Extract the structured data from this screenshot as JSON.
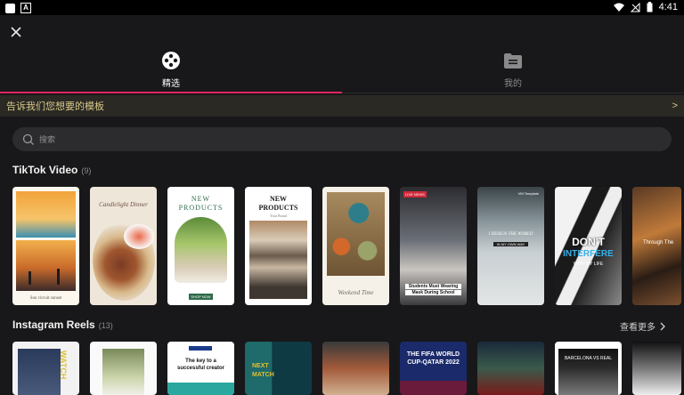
{
  "status_bar": {
    "time": "4:41",
    "badge": "A"
  },
  "tabs": [
    {
      "label": "精选",
      "active": true,
      "icon": "film-reel-icon"
    },
    {
      "label": "我的",
      "active": false,
      "icon": "folder-icon"
    }
  ],
  "banner": {
    "text": "告诉我们您想要的模板",
    "arrow": ">"
  },
  "search": {
    "placeholder": "搜索"
  },
  "sections": [
    {
      "title": "TikTok Video",
      "count": "(9)",
      "cards": [
        {
          "line1": "",
          "line2": "Sun circuit sunset"
        },
        {
          "line1": "Candlelight Dinner",
          "line2": ""
        },
        {
          "line1": "NEW",
          "line2": "PRODUCTS",
          "cta": "SHOP NOW"
        },
        {
          "line1": "NEW",
          "line2": "PRODUCTS",
          "sub": "Your Brand"
        },
        {
          "line1": "",
          "line2": "Weekend Time"
        },
        {
          "line1": "Students Must Wearing",
          "line2": "Mask During School",
          "tag": "LIVE NEWS"
        },
        {
          "line1": "I DESIGN THE WORLD",
          "line2": "IN MY OWN WAY",
          "tag": "VM Template"
        },
        {
          "line1": "DON'T",
          "line2": "INTERFERE",
          "line3": "WITH MY LIFE"
        },
        {
          "line1": "Through The",
          "line2": ""
        }
      ]
    },
    {
      "title": "Instagram Reels",
      "count": "(13)",
      "see_more": "查看更多",
      "cards": [
        {
          "line1": "WATCH",
          "line2": ""
        },
        {
          "line1": "",
          "line2": ""
        },
        {
          "line1": "The key to a",
          "line2": "successful creator"
        },
        {
          "line1": "NEXT",
          "line2": "MATCH"
        },
        {
          "line1": "",
          "line2": ""
        },
        {
          "line1": "THE FIFA WORLD",
          "line2": "CUP-QATAR 2022"
        },
        {
          "line1": "",
          "line2": ""
        },
        {
          "line1": "BARCELONA VS REAL",
          "line2": ""
        },
        {
          "line1": "",
          "line2": ""
        }
      ]
    }
  ],
  "colors": {
    "accent": "#e0245e",
    "banner_text": "#d8c98a",
    "background": "#18181a"
  }
}
